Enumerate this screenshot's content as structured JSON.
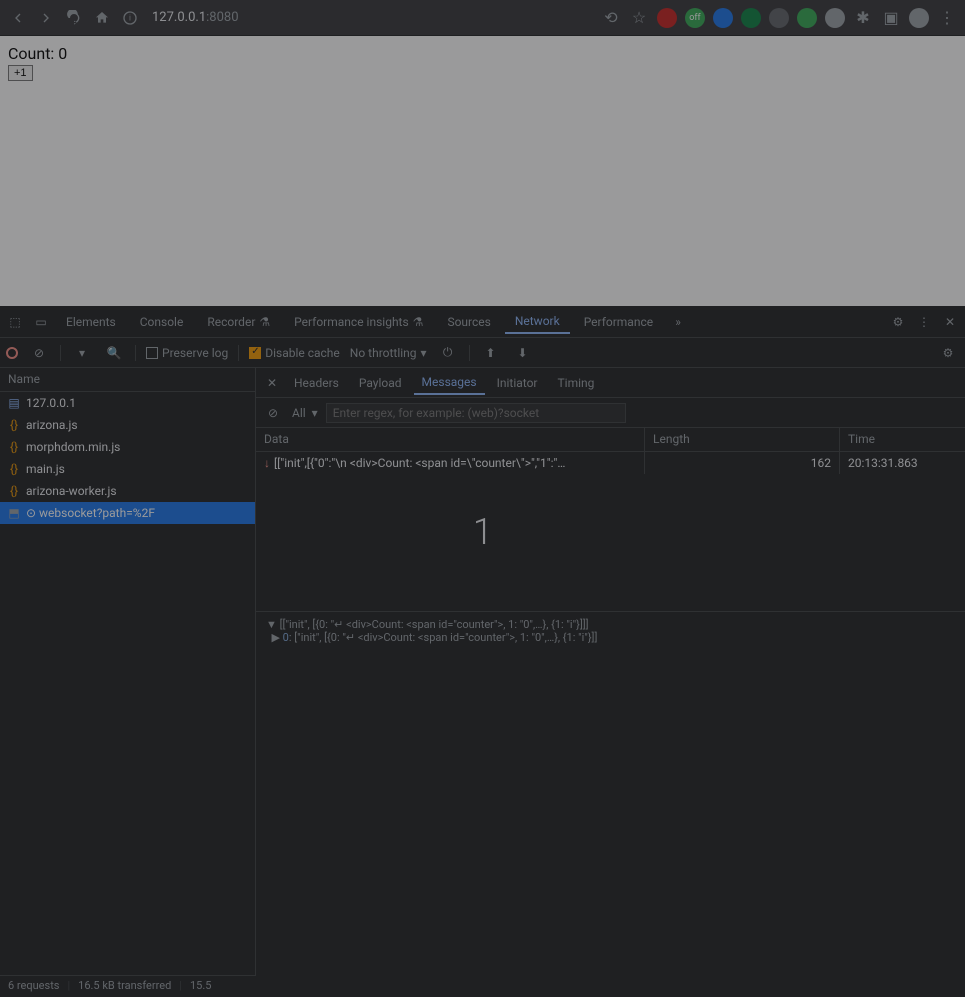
{
  "browser": {
    "url_host": "127.0.0.1",
    "url_port": ":8080"
  },
  "page": {
    "count_label": "Count: 0",
    "plus_button": "+1"
  },
  "devtools": {
    "tabs": [
      "Elements",
      "Console",
      "Recorder",
      "Performance insights",
      "Sources",
      "Network",
      "Performance"
    ],
    "active_tab": "Network"
  },
  "network_toolbar": {
    "preserve_log": "Preserve log",
    "disable_cache": "Disable cache",
    "throttling": "No throttling"
  },
  "requests": {
    "header": "Name",
    "items": [
      {
        "name": "127.0.0.1",
        "type": "doc"
      },
      {
        "name": "arizona.js",
        "type": "js"
      },
      {
        "name": "morphdom.min.js",
        "type": "js"
      },
      {
        "name": "main.js",
        "type": "js"
      },
      {
        "name": "arizona-worker.js",
        "type": "js"
      },
      {
        "name": "websocket?path=%2F",
        "type": "ws"
      }
    ],
    "selected": 5
  },
  "status_bar": {
    "requests": "6 requests",
    "transferred": "16.5 kB transferred",
    "resources": "15.5"
  },
  "detail": {
    "tabs": [
      "Headers",
      "Payload",
      "Messages",
      "Initiator",
      "Timing"
    ],
    "active": "Messages",
    "filter_label": "All",
    "regex_placeholder": "Enter regex, for example: (web)?socket"
  },
  "messages": {
    "headers": {
      "data": "Data",
      "length": "Length",
      "time": "Time"
    },
    "rows": [
      {
        "data": "[[\"init\",[{\"0\":\"\\n <div>Count: <span id=\\\"counter\\\">\",\"1\":\"…",
        "length": "162",
        "time": "20:13:31.863"
      }
    ],
    "big_number": "1"
  },
  "expanded": {
    "line1": "[[\"init\", [{0: \"↵ <div>Count: <span id=\"counter\">, 1: \"0\",…}, {1: \"i\"}]]]",
    "line2_idx": "0",
    "line2_rest": ": [\"init\", [{0: \"↵ <div>Count: <span id=\"counter\">, 1: \"0\",…}, {1: \"i\"}]]"
  }
}
